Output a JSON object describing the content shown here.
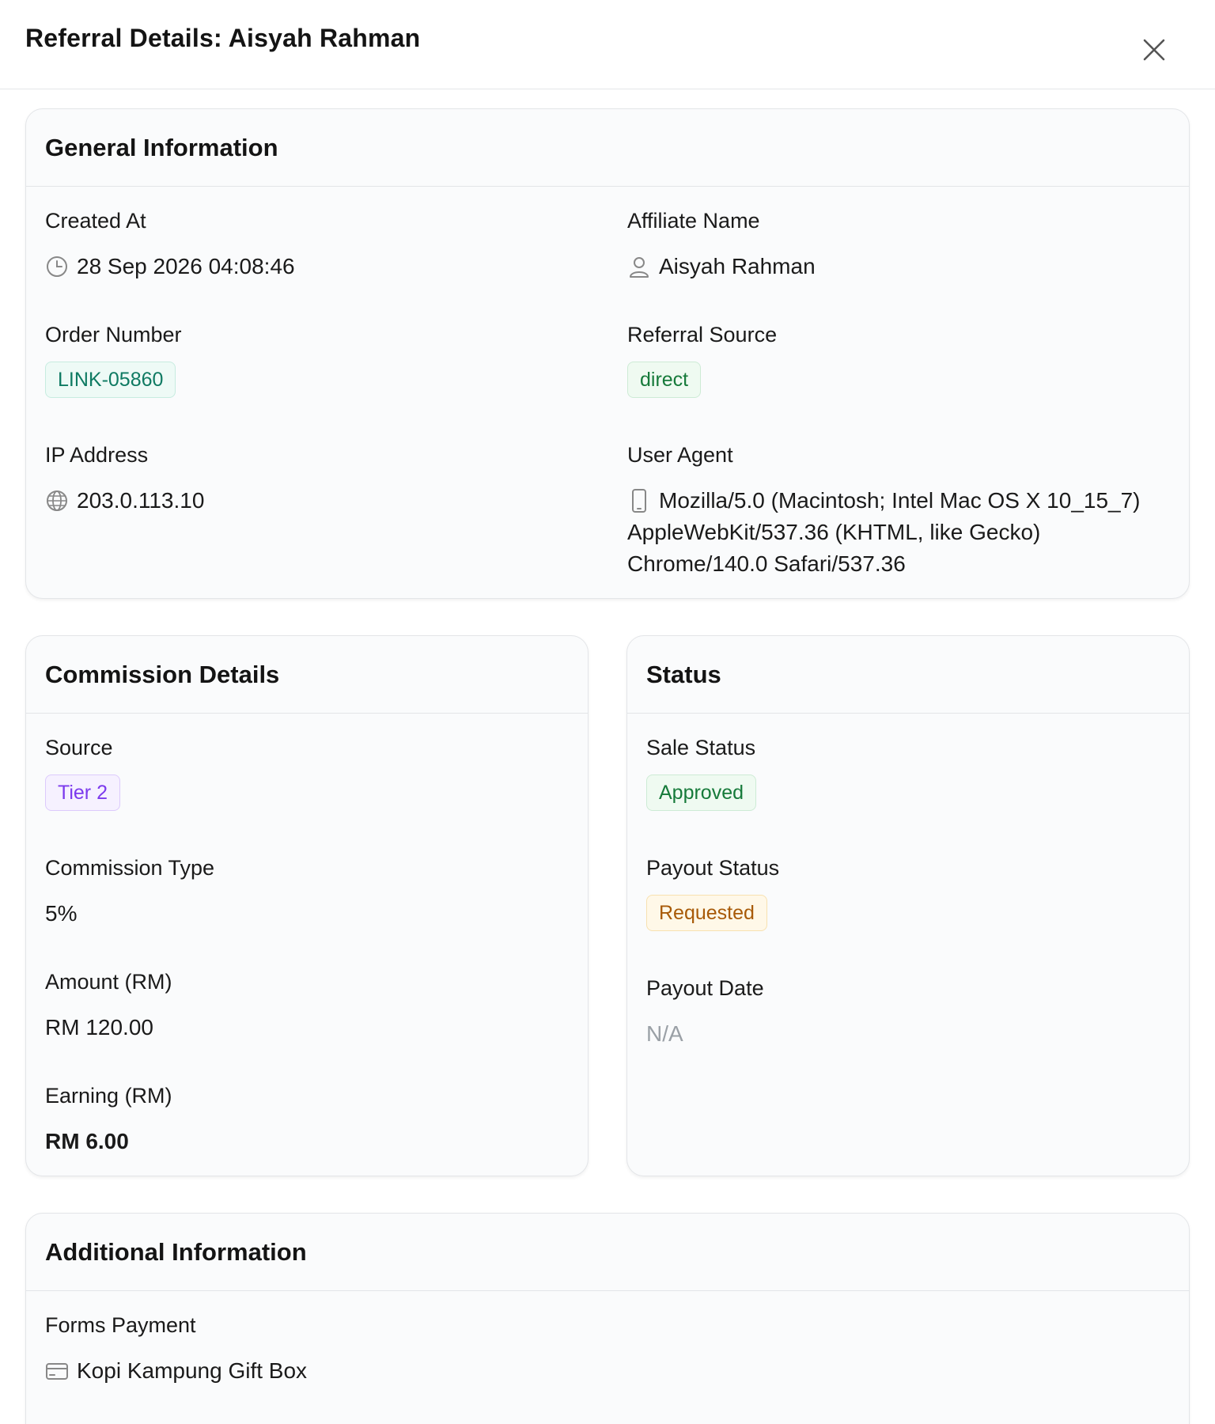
{
  "header": {
    "title": "Referral Details: Aisyah Rahman"
  },
  "general": {
    "title": "General Information",
    "created_at_label": "Created At",
    "created_at": "28 Sep 2026 04:08:46",
    "affiliate_label": "Affiliate Name",
    "affiliate": "Aisyah Rahman",
    "order_label": "Order Number",
    "order": "LINK-05860",
    "source_label": "Referral Source",
    "source": "direct",
    "ip_label": "IP Address",
    "ip": "203.0.113.10",
    "ua_label": "User Agent",
    "ua_line1": "Mozilla/5.0 (Macintosh; Intel Mac OS X 10_15_7)",
    "ua_line2": "AppleWebKit/537.36 (KHTML, like Gecko)",
    "ua_line3": "Chrome/140.0 Safari/537.36"
  },
  "commission": {
    "title": "Commission Details",
    "source_label": "Source",
    "source": "Tier 2",
    "type_label": "Commission Type",
    "type": "5%",
    "amount_label": "Amount (RM)",
    "amount": "RM 120.00",
    "earning_label": "Earning (RM)",
    "earning": "RM 6.00"
  },
  "status": {
    "title": "Status",
    "sale_label": "Sale Status",
    "sale": "Approved",
    "payout_label": "Payout Status",
    "payout": "Requested",
    "payout_date_label": "Payout Date",
    "payout_date": "N/A"
  },
  "additional": {
    "title": "Additional Information",
    "forms_label": "Forms Payment",
    "forms": "Kopi Kampung Gift Box"
  },
  "icons": {
    "close": "close-icon",
    "clock": "clock-icon",
    "user": "user-icon",
    "globe": "globe-icon",
    "phone": "phone-icon",
    "card": "credit-card-icon"
  },
  "colors": {
    "teal_badge": "#0f7a62",
    "green_badge": "#167a3a",
    "purple_badge": "#7c3aed",
    "amber_badge": "#a85a08",
    "muted_text": "#9aa0a6"
  }
}
